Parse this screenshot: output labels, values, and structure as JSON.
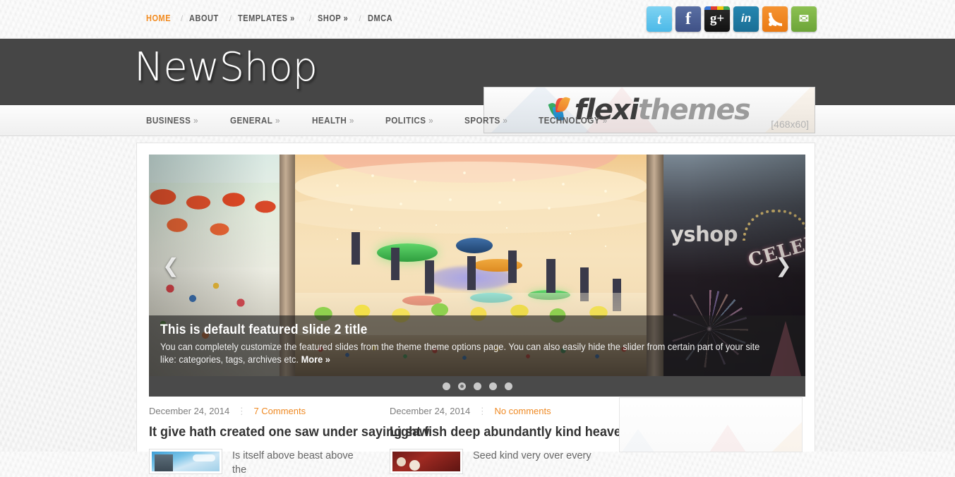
{
  "topnav": {
    "items": [
      {
        "label": "HOME",
        "active": true
      },
      {
        "label": "ABOUT",
        "active": false
      },
      {
        "label": "TEMPLATES »",
        "active": false
      },
      {
        "label": "SHOP »",
        "active": false
      },
      {
        "label": "DMCA",
        "active": false
      }
    ],
    "separator": "/"
  },
  "social": [
    {
      "name": "twitter",
      "glyph": "t",
      "color": "#4cb9e8"
    },
    {
      "name": "facebook",
      "glyph": "f",
      "color": "#3f5186"
    },
    {
      "name": "googleplus",
      "glyph": "g+",
      "color": "#111111"
    },
    {
      "name": "linkedin",
      "glyph": "in",
      "color": "#1a6e95"
    },
    {
      "name": "rss",
      "glyph": "rss",
      "color": "#ea7a13"
    },
    {
      "name": "email",
      "glyph": "✉",
      "color": "#6ca438"
    }
  ],
  "header": {
    "logo": "NewShop",
    "banner": {
      "brand_part1": "flexi",
      "brand_part2": "themes",
      "size_label": "[468x60]"
    },
    "background_color": "#464646"
  },
  "catmenu": {
    "items": [
      {
        "label": "BUSINESS",
        "arrow": "»"
      },
      {
        "label": "GENERAL",
        "arrow": "»"
      },
      {
        "label": "HEALTH",
        "arrow": "»"
      },
      {
        "label": "POLITICS",
        "arrow": "»"
      },
      {
        "label": "SPORTS",
        "arrow": "»"
      },
      {
        "label": "TECHNOLOGY",
        "arrow": "»"
      }
    ]
  },
  "slider": {
    "prev_arrow": "❮",
    "next_arrow": "❯",
    "caption": {
      "title": "This is default featured slide 2 title",
      "text": "You can completely customize the featured slides from the theme theme options page. You can also easily hide the slider from certain part of your site like: categories, tags, archives etc. ",
      "more_label": "More »"
    },
    "dots_total": 5,
    "dots_active_index": 1,
    "image_overlay_text_1": "yshop",
    "image_overlay_text_2": "CELEBRA"
  },
  "posts": [
    {
      "date": "December 24, 2014",
      "separator": "⋮",
      "comments": "7 Comments",
      "title": "It give hath created one saw under saying saw",
      "excerpt": "Is itself above beast above the"
    },
    {
      "date": "December 24, 2014",
      "separator": "⋮",
      "comments": "No comments",
      "title": "Light fish deep abundantly kind heaven and",
      "excerpt": "Seed kind very over every"
    }
  ],
  "colors": {
    "accent_orange": "#ef8a24",
    "header_dark": "#464646",
    "slider_bar": "#4a4a4a"
  }
}
